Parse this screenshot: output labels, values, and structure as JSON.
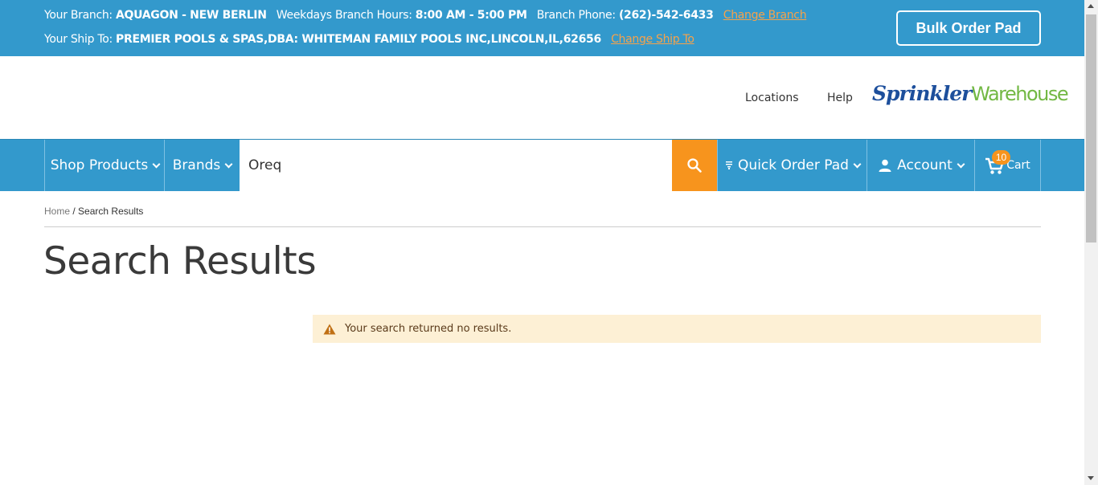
{
  "topbar": {
    "branch_label": "Your Branch:",
    "branch_value": "AQUAGON - NEW BERLIN",
    "hours_label": "Weekdays Branch Hours:",
    "hours_value": "8:00 AM - 5:00 PM",
    "phone_label": "Branch Phone:",
    "phone_value": "(262)-542-6433",
    "change_branch": "Change Branch",
    "shipto_label": "Your Ship To:",
    "shipto_value": "PREMIER POOLS & SPAS,DBA: WHITEMAN FAMILY POOLS INC,LINCOLN,IL,62656",
    "change_shipto": "Change Ship To",
    "bulk_order_pad": "Bulk Order Pad",
    "link_color": "#f7a24a",
    "bg_color": "#3399cc"
  },
  "header": {
    "locations": "Locations",
    "help": "Help",
    "logo_part1": "Sprinkler",
    "logo_part2": "Warehouse"
  },
  "nav": {
    "shop_products": "Shop Products",
    "brands": "Brands",
    "search_value": "Oreq",
    "search_icon": "search-icon",
    "quick_order_pad": "Quick Order Pad",
    "account": "Account",
    "cart": "Cart",
    "cart_count": "10",
    "accent_color": "#f7941d"
  },
  "breadcrumb": {
    "home": "Home",
    "separator": "/",
    "current": "Search Results"
  },
  "main": {
    "title": "Search Results",
    "notice": "Your search returned no results.",
    "notice_icon": "warning-icon"
  }
}
